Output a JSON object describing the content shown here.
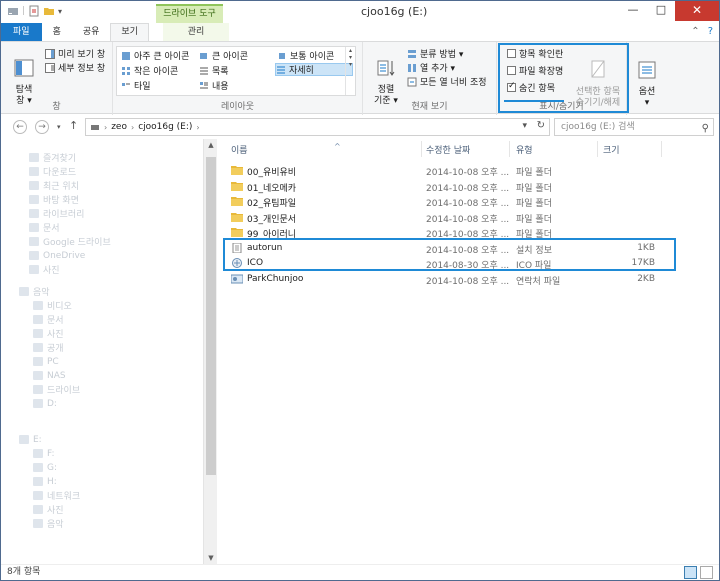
{
  "window": {
    "title": "cjoo16g (E:)",
    "context_tab_header": "드라이브 도구",
    "buttons": [
      "—",
      "□",
      "✕"
    ]
  },
  "tabs": [
    {
      "label": "파일"
    },
    {
      "label": "홈"
    },
    {
      "label": "공유"
    },
    {
      "label": "보기"
    },
    {
      "label": "관리"
    }
  ],
  "ribbon": {
    "pane": {
      "nav_pane_label": "탐색\n창 ▾",
      "preview": "미리 보기 창",
      "details": "세부 정보 창",
      "group_label": "창"
    },
    "layout": {
      "items": [
        "아주 큰 아이콘",
        "큰 아이콘",
        "보통 아이콘",
        "작은 아이콘",
        "목록",
        "자세히",
        "타일",
        "내용"
      ],
      "group_label": "레이아웃"
    },
    "current_view": {
      "sort_label": "정렬\n기준 ▾",
      "group_by": "분류 방법 ▾",
      "add_columns": "열 추가 ▾",
      "fit_columns": "모든 열 너비 조정",
      "group_label": "현재 보기"
    },
    "show_hide": {
      "item_checkboxes": "항목 확인란",
      "file_extensions": "파일 확장명",
      "hidden_items": "숨긴 항목",
      "hide_selected": "선택한 항목\n숨기기/해제",
      "group_label": "표시/숨기기"
    },
    "options_label": "옵션\n▾"
  },
  "address": {
    "path": [
      "zeo",
      "cjoo16g (E:)"
    ],
    "search_placeholder": "cjoo16g (E:) 검색"
  },
  "nav_pane": {
    "items": [
      "즐겨찾기",
      "다운로드",
      "최근 위치",
      "바탕 화면",
      "라이브러리",
      "문서",
      "Google 드라이브",
      "OneDrive",
      "사진",
      "음악",
      "비디오",
      "문서",
      "사진",
      "공개",
      "PC",
      "NAS",
      "드라이브",
      "D:",
      "E:",
      "F:",
      "G:",
      "H:",
      "네트워크",
      "사진",
      "음악"
    ]
  },
  "columns": {
    "name": "이름",
    "modified": "수정한 날짜",
    "type": "유형",
    "size": "크기"
  },
  "files": [
    {
      "name": "00_유비유비",
      "date": "2014-10-08 오후 ...",
      "type": "파일 폴더",
      "size": "",
      "kind": "folder"
    },
    {
      "name": "01_네오메카",
      "date": "2014-10-08 오후 ...",
      "type": "파일 폴더",
      "size": "",
      "kind": "folder"
    },
    {
      "name": "02_유팀파일",
      "date": "2014-10-08 오후 ...",
      "type": "파일 폴더",
      "size": "",
      "kind": "folder"
    },
    {
      "name": "03_개인문서",
      "date": "2014-10-08 오후 ...",
      "type": "파일 폴더",
      "size": "",
      "kind": "folder"
    },
    {
      "name": "99_아이러니",
      "date": "2014-10-08 오후 ...",
      "type": "파일 폴더",
      "size": "",
      "kind": "folder"
    },
    {
      "name": "autorun",
      "date": "2014-10-08 오후 ...",
      "type": "설치 정보",
      "size": "1KB",
      "kind": "inf"
    },
    {
      "name": "ICO",
      "date": "2014-08-30 오후 ...",
      "type": "ICO 파일",
      "size": "17KB",
      "kind": "ico"
    },
    {
      "name": "ParkChunjoo",
      "date": "2014-10-08 오후 ...",
      "type": "연락처 파일",
      "size": "2KB",
      "kind": "contact"
    }
  ],
  "status": {
    "count": "8개 항목"
  },
  "colors": {
    "accent": "#1979ca",
    "highlight": "#1f8ad6",
    "folder": "#e8b93a"
  }
}
